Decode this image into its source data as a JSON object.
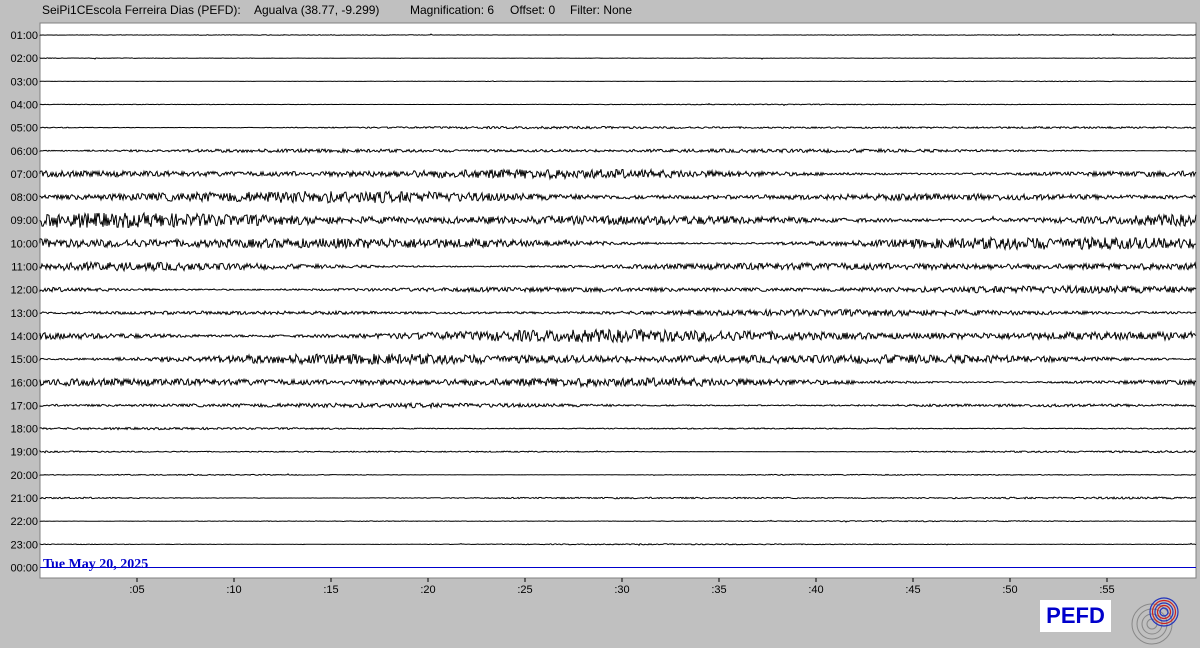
{
  "header": {
    "station": "SeiPi1CEscola Ferreira Dias (PEFD):",
    "location": "Agualva (38.77, -9.299)",
    "magnification": "Magnification: 6",
    "offset": "Offset: 0",
    "filter": "Filter: None"
  },
  "date_label": "Tue May 20, 2025",
  "badge": "PEFD",
  "logo_icon": "seismograph-logo-icon",
  "colors": {
    "background": "#c0c0c0",
    "plot_bg": "#ffffff",
    "trace": "#000000",
    "current_line": "#0000cc",
    "date_text": "#0000cc"
  },
  "chart_data": {
    "type": "line",
    "title": "",
    "xlabel": "",
    "ylabel": "",
    "x_ticks": [
      ":05",
      ":10",
      ":15",
      ":20",
      ":25",
      ":30",
      ":35",
      ":40",
      ":45",
      ":50",
      ":55"
    ],
    "x_range_minutes": [
      0,
      60
    ],
    "rows": [
      "01:00",
      "02:00",
      "03:00",
      "04:00",
      "05:00",
      "06:00",
      "07:00",
      "08:00",
      "09:00",
      "10:00",
      "11:00",
      "12:00",
      "13:00",
      "14:00",
      "15:00",
      "16:00",
      "17:00",
      "18:00",
      "19:00",
      "20:00",
      "21:00",
      "22:00",
      "23:00",
      "00:00"
    ],
    "activity_level": [
      0.03,
      0.03,
      0.03,
      0.04,
      0.12,
      0.2,
      0.45,
      0.55,
      0.7,
      0.65,
      0.45,
      0.35,
      0.3,
      0.6,
      0.55,
      0.45,
      0.22,
      0.1,
      0.09,
      0.06,
      0.1,
      0.05,
      0.05,
      0.0
    ],
    "current_row": "00:00"
  }
}
